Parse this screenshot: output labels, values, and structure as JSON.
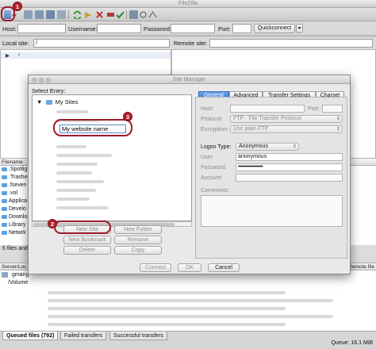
{
  "window": {
    "title": "FileZilla"
  },
  "quickconnect": {
    "host_label": "Host:",
    "username_label": "Username:",
    "password_label": "Password:",
    "port_label": "Port:",
    "button_label": "Quickconnect"
  },
  "local": {
    "label": "Local site:",
    "path": "/",
    "tree_root": "/",
    "header": "Filename",
    "files": [
      ".Spotlig",
      ".Trashe",
      ".fseven",
      ".vol",
      "Applica",
      "Develo",
      "Downlo",
      "Library",
      "Netwrk"
    ],
    "status": "6 files and"
  },
  "remote": {
    "label": "Remote site:"
  },
  "queue": {
    "header_left": "Server/Loc",
    "header_right": "Remote file",
    "rows": [
      "gmang",
      "/Volume"
    ],
    "tabs": [
      "Queued files (792)",
      "Failed transfers",
      "Successful transfers"
    ],
    "status": "Queue: 16.1 MiB"
  },
  "site_manager": {
    "title": "Site Manager",
    "select_entry_label": "Select Entry:",
    "root_folder": "My Sites",
    "new_site_name": "My website name",
    "buttons": {
      "new_site": "New Site",
      "new_folder": "New Folder",
      "new_bookmark": "New Bookmark",
      "rename": "Rename",
      "delete": "Delete",
      "copy": "Copy",
      "connect": "Connect",
      "ok": "OK",
      "cancel": "Cancel"
    },
    "tabs": [
      "General",
      "Advanced",
      "Transfer Settings",
      "Charset"
    ],
    "general": {
      "host_label": "Host:",
      "port_label": "Port:",
      "protocol_label": "Protocol:",
      "protocol_value": "FTP - File Transfer Protocol",
      "encryption_label": "Encryption:",
      "encryption_value": "Use plain FTP",
      "logon_type_label": "Logon Type:",
      "logon_type_value": "Anonymous",
      "user_label": "User:",
      "user_value": "anonymous",
      "password_label": "Password:",
      "password_value": "••••••••••••••••",
      "account_label": "Account:",
      "comments_label": "Comments:"
    }
  },
  "callouts": {
    "step1": "1",
    "step2": "2",
    "step3": "3"
  },
  "colors": {
    "accent_tab": "#3b78d0",
    "callout_red": "#9c1a2a",
    "folder_blue": "#5aa0e6"
  }
}
